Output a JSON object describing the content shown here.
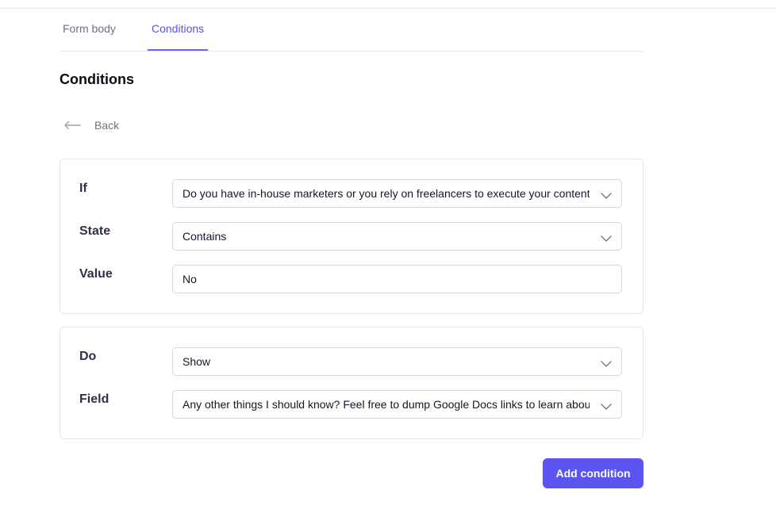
{
  "tabs": [
    {
      "label": "Form body",
      "active": false
    },
    {
      "label": "Conditions",
      "active": true
    }
  ],
  "page_title": "Conditions",
  "back_label": "Back",
  "condition": {
    "if": {
      "label": "If",
      "value": "Do you have in-house marketers or you rely on freelancers to execute your content strategy?",
      "icon": "chevron-down-icon"
    },
    "state": {
      "label": "State",
      "value": "Contains",
      "icon": "chevron-down-icon"
    },
    "value": {
      "label": "Value",
      "value": "No"
    }
  },
  "action": {
    "do": {
      "label": "Do",
      "value": "Show",
      "icon": "chevron-down-icon"
    },
    "field": {
      "label": "Field",
      "value": "Any other things I should know? Feel free to dump Google Docs links to learn about your business",
      "icon": "chevron-down-icon"
    }
  },
  "add_condition_label": "Add condition",
  "colors": {
    "accent": "#5c54f0",
    "tab_active": "#5b4fe6",
    "border": "#e5e7eb"
  }
}
